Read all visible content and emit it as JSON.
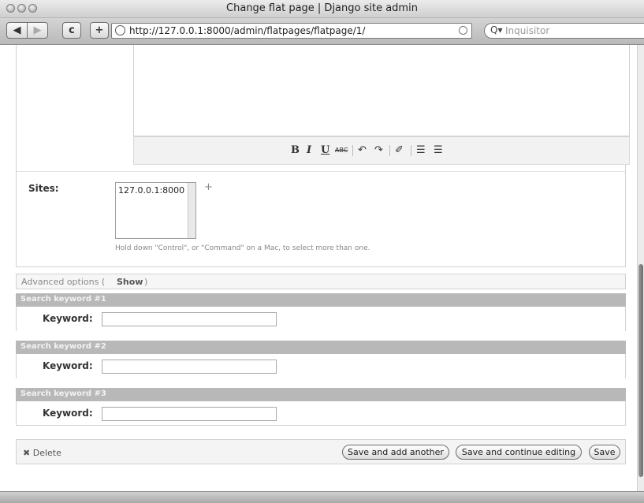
{
  "window": {
    "title": "Change flat page | Django site admin"
  },
  "browser": {
    "url": "http://127.0.0.1:8000/admin/flatpages/flatpage/1/",
    "search_placeholder": "Inquisitor",
    "back_icon": "back-arrow-icon",
    "forward_icon": "forward-arrow-icon",
    "reload_label": "c",
    "add_label": "+"
  },
  "editor": {
    "tools": [
      "B",
      "I",
      "U",
      "ABC",
      "↶",
      "↷",
      "✐",
      "☰",
      "☰"
    ]
  },
  "sites": {
    "label": "Sites:",
    "option": "127.0.0.1:8000",
    "add_icon": "+",
    "help": "Hold down \"Control\", or \"Command\" on a Mac, to select more than one."
  },
  "advanced": {
    "label": "Advanced options (",
    "show": "Show",
    "close": ")"
  },
  "keywords": [
    {
      "header": "Search keyword #1",
      "label": "Keyword:",
      "value": ""
    },
    {
      "header": "Search keyword #2",
      "label": "Keyword:",
      "value": ""
    },
    {
      "header": "Search keyword #3",
      "label": "Keyword:",
      "value": ""
    }
  ],
  "submit": {
    "delete_icon": "✖",
    "delete": "Delete",
    "save_add": "Save and add another",
    "save_continue": "Save and continue editing",
    "save": "Save"
  }
}
